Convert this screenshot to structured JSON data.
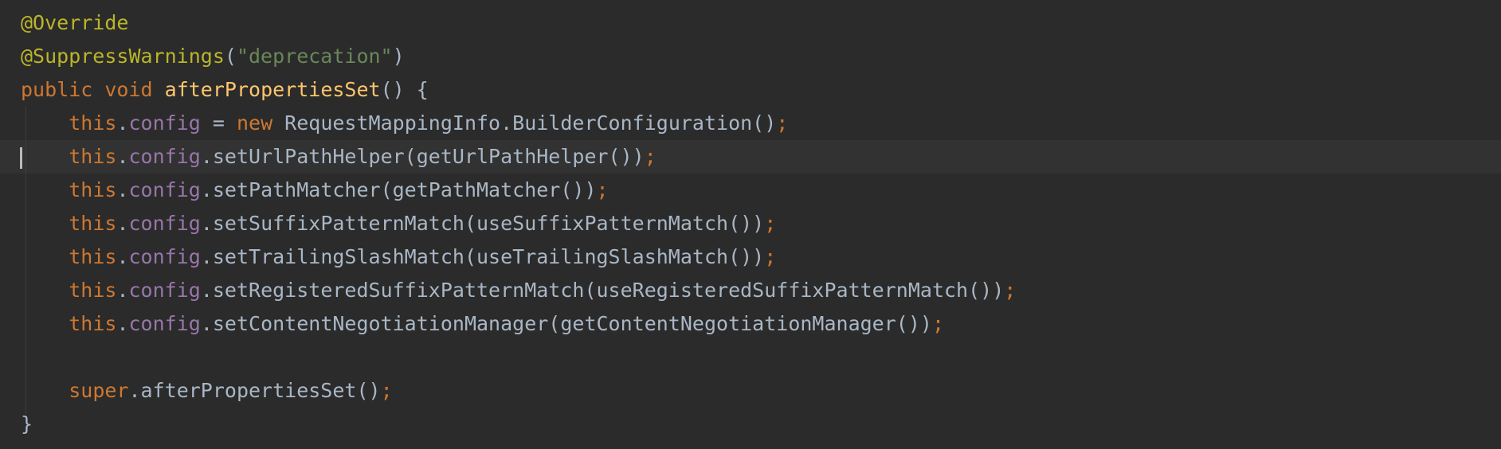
{
  "editor": {
    "colors": {
      "background": "#2b2b2b",
      "current_line": "#323232",
      "annotation": "#bbb529",
      "string": "#6a8759",
      "keyword": "#cc7832",
      "method_declaration": "#ffc66d",
      "field": "#9876aa",
      "plain": "#a9b7c6"
    },
    "caret_line": 5,
    "lines": [
      {
        "annotation": "@Override"
      },
      {
        "annotation": "@SuppressWarnings",
        "open": "(",
        "string": "\"deprecation\"",
        "close": ")"
      },
      {
        "kw1": "public",
        "kw2": "void",
        "method": "afterPropertiesSet",
        "rest": "() {"
      },
      {
        "indent": "    ",
        "this": "this",
        "dot": ".",
        "field": "config",
        "mid": " = ",
        "new": "new",
        "rest": " RequestMappingInfo.BuilderConfiguration()",
        "semi": ";"
      },
      {
        "indent": "    ",
        "this": "this",
        "dot": ".",
        "field": "config",
        "rest": ".setUrlPathHelper(getUrlPathHelper())",
        "semi": ";"
      },
      {
        "indent": "    ",
        "this": "this",
        "dot": ".",
        "field": "config",
        "rest": ".setPathMatcher(getPathMatcher())",
        "semi": ";"
      },
      {
        "indent": "    ",
        "this": "this",
        "dot": ".",
        "field": "config",
        "rest": ".setSuffixPatternMatch(useSuffixPatternMatch())",
        "semi": ";"
      },
      {
        "indent": "    ",
        "this": "this",
        "dot": ".",
        "field": "config",
        "rest": ".setTrailingSlashMatch(useTrailingSlashMatch())",
        "semi": ";"
      },
      {
        "indent": "    ",
        "this": "this",
        "dot": ".",
        "field": "config",
        "rest": ".setRegisteredSuffixPatternMatch(useRegisteredSuffixPatternMatch())",
        "semi": ";"
      },
      {
        "indent": "    ",
        "this": "this",
        "dot": ".",
        "field": "config",
        "rest": ".setContentNegotiationManager(getContentNegotiationManager())",
        "semi": ";"
      },
      {
        "text": ""
      },
      {
        "indent": "    ",
        "super": "super",
        "rest": ".afterPropertiesSet()",
        "semi": ";"
      },
      {
        "text": "}"
      }
    ]
  }
}
